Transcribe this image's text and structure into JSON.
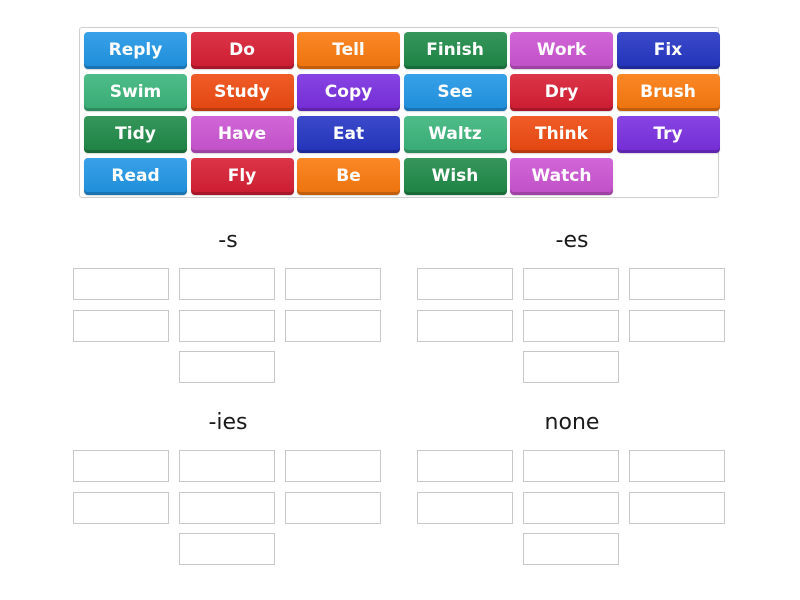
{
  "tiles": [
    {
      "label": "Reply",
      "color": "#2196e6"
    },
    {
      "label": "Do",
      "color": "#d81e34"
    },
    {
      "label": "Tell",
      "color": "#fb7a0e"
    },
    {
      "label": "Finish",
      "color": "#1f8a48"
    },
    {
      "label": "Work",
      "color": "#cc55d3"
    },
    {
      "label": "Fix",
      "color": "#2536c4"
    },
    {
      "label": "Swim",
      "color": "#3bb57b"
    },
    {
      "label": "Study",
      "color": "#ef4a10"
    },
    {
      "label": "Copy",
      "color": "#7a2fe0"
    },
    {
      "label": "See",
      "color": "#2196e6"
    },
    {
      "label": "Dry",
      "color": "#d81e34"
    },
    {
      "label": "Brush",
      "color": "#fb7a0e"
    },
    {
      "label": "Tidy",
      "color": "#1f8a48"
    },
    {
      "label": "Have",
      "color": "#cc55d3"
    },
    {
      "label": "Eat",
      "color": "#2536c4"
    },
    {
      "label": "Waltz",
      "color": "#3bb57b"
    },
    {
      "label": "Think",
      "color": "#ef4a10"
    },
    {
      "label": "Try",
      "color": "#7a2fe0"
    },
    {
      "label": "Read",
      "color": "#2196e6"
    },
    {
      "label": "Fly",
      "color": "#d81e34"
    },
    {
      "label": "Be",
      "color": "#fb7a0e"
    },
    {
      "label": "Wish",
      "color": "#1f8a48"
    },
    {
      "label": "Watch",
      "color": "#cc55d3"
    }
  ],
  "groups": [
    {
      "title": "-s",
      "slot_count": 7
    },
    {
      "title": "-es",
      "slot_count": 7
    },
    {
      "title": "-ies",
      "slot_count": 7
    },
    {
      "title": "none",
      "slot_count": 7
    }
  ]
}
